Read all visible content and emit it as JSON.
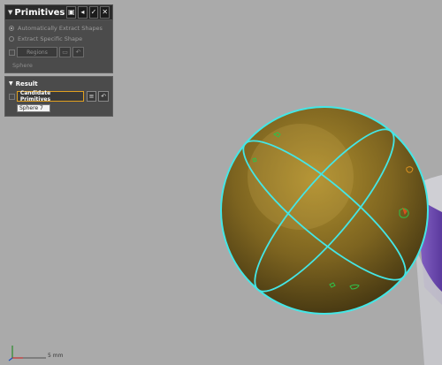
{
  "panel": {
    "title": "Primitives",
    "options": [
      "Automatically Extract Shapes",
      "Extract Specific Shape"
    ],
    "regions_label": "Regions",
    "sphere_label": "Sphere"
  },
  "result": {
    "header": "Result",
    "candidate_label": "Candidate Primitives",
    "sphere_value": "Sphere 7"
  },
  "viewport": {
    "scale_unit": "5 mm",
    "colors": {
      "background": "#aaaaaa",
      "sphere_fill": "#7a6220",
      "fit_lines": "#44e6e6",
      "outlines": "#2ec24a"
    }
  }
}
